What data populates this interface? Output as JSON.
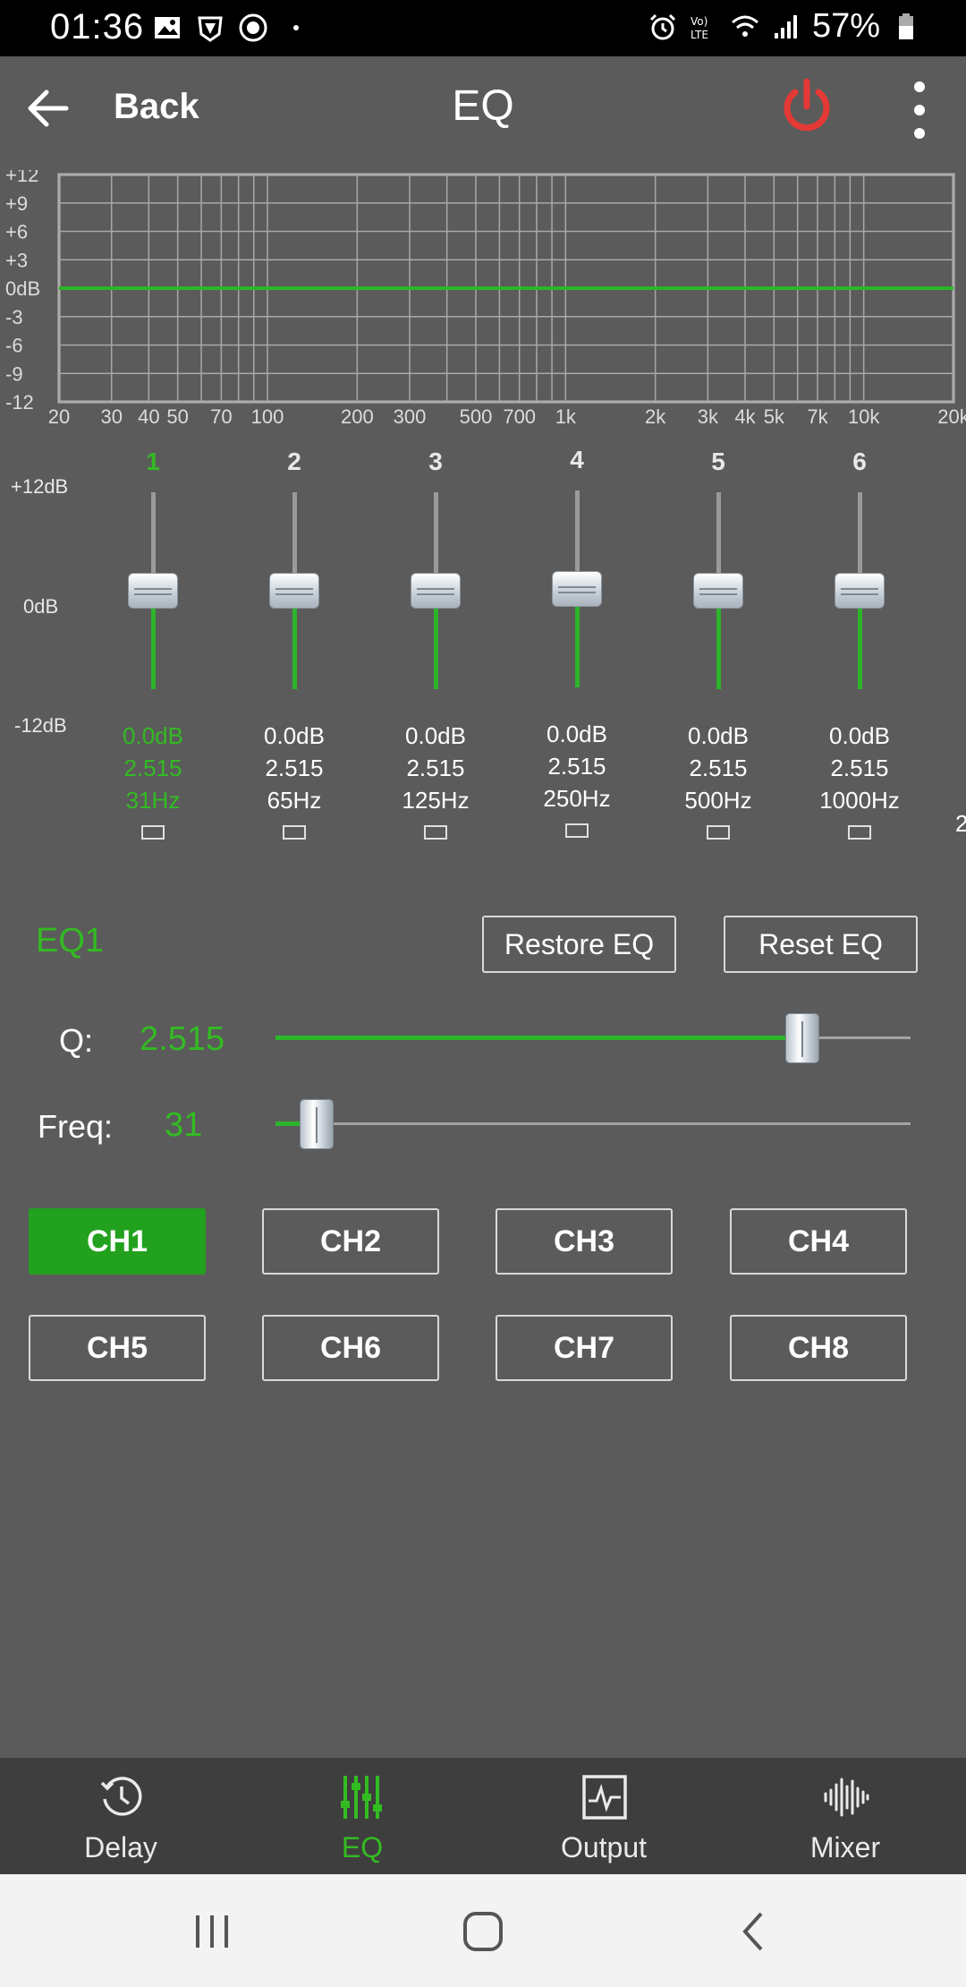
{
  "status_bar": {
    "time": "01:36",
    "battery": "57%"
  },
  "header": {
    "back_label": "Back",
    "title": "EQ"
  },
  "graph": {
    "y_ticks": [
      "+12",
      "+9",
      "+6",
      "+3",
      "0dB",
      "-3",
      "-6",
      "-9",
      "-12"
    ],
    "x_ticks": [
      "20",
      "30",
      "40",
      "50",
      "70",
      "100",
      "200",
      "300",
      "500",
      "700",
      "1k",
      "2k",
      "3k",
      "4k",
      "5k",
      "7k",
      "10k",
      "20k"
    ],
    "curve_gain_db": 0,
    "curve_color": "#2db52a"
  },
  "db_scale": {
    "top": "+12dB",
    "mid": "0dB",
    "bottom": "-12dB"
  },
  "faders": [
    {
      "num": "1",
      "gain": "0.0dB",
      "q": "2.515",
      "freq": "31Hz",
      "active": true
    },
    {
      "num": "2",
      "gain": "0.0dB",
      "q": "2.515",
      "freq": "65Hz",
      "active": false
    },
    {
      "num": "3",
      "gain": "0.0dB",
      "q": "2.515",
      "freq": "125Hz",
      "active": false
    },
    {
      "num": "4",
      "gain": "0.0dB",
      "q": "2.515",
      "freq": "250Hz",
      "active": false
    },
    {
      "num": "5",
      "gain": "0.0dB",
      "q": "2.515",
      "freq": "500Hz",
      "active": false
    },
    {
      "num": "6",
      "gain": "0.0dB",
      "q": "2.515",
      "freq": "1000Hz",
      "active": false
    }
  ],
  "eq": {
    "name": "EQ1",
    "restore_label": "Restore EQ",
    "reset_label": "Reset EQ",
    "q_label": "Q:",
    "q_value": "2.515",
    "q_slider_fraction": 0.83,
    "freq_label": "Freq:",
    "freq_value": "31",
    "freq_slider_fraction": 0.065
  },
  "channels": [
    "CH1",
    "CH2",
    "CH3",
    "CH4",
    "CH5",
    "CH6",
    "CH7",
    "CH8"
  ],
  "active_channel": "CH1",
  "bottom_nav": [
    {
      "label": "Delay",
      "icon": "clock-icon",
      "active": false
    },
    {
      "label": "EQ",
      "icon": "sliders-icon",
      "active": true
    },
    {
      "label": "Output",
      "icon": "waveform-box-icon",
      "active": false
    },
    {
      "label": "Mixer",
      "icon": "audio-wave-icon",
      "active": false
    }
  ],
  "colors": {
    "accent": "#33bb22",
    "background": "#5b5b5b",
    "power": "#e53935"
  }
}
